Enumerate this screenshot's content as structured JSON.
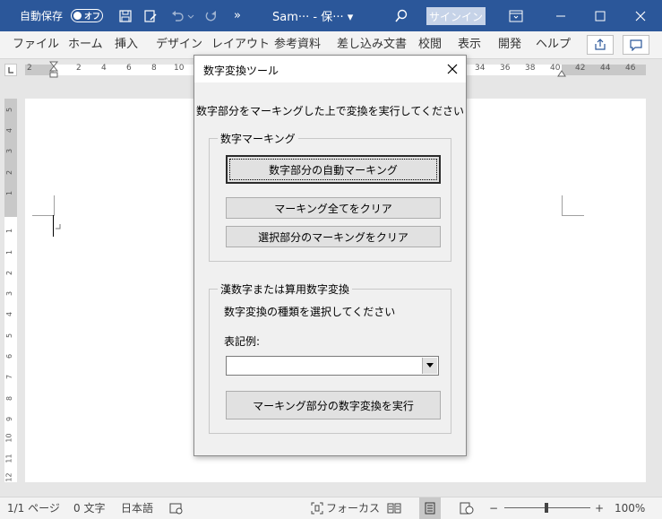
{
  "titlebar": {
    "autosave_label": "自動保存",
    "autosave_toggle": "オフ",
    "doc_title": "Sam···  - 保··· ▾",
    "signin_label": "サインイン",
    "bg_color": "#2b579a"
  },
  "ribbon": {
    "tabs": [
      "ファイル",
      "ホーム",
      "挿入",
      "デザイン",
      "レイアウト",
      "参考資料",
      "差し込み文書",
      "校閲",
      "表示",
      "開発",
      "ヘルプ"
    ]
  },
  "ruler": {
    "left_numbers": [
      "2",
      "2",
      "4",
      "6",
      "8",
      "10"
    ],
    "right_numbers": [
      "34",
      "36",
      "38",
      "40",
      "42",
      "44",
      "46"
    ]
  },
  "vruler": {
    "numbers": [
      "5",
      "4",
      "3",
      "2",
      "1",
      "1",
      "1",
      "2",
      "3",
      "4",
      "5",
      "6",
      "7",
      "8",
      "9",
      "10",
      "11",
      "12"
    ]
  },
  "dialog": {
    "title": "数字変換ツール",
    "instruction": "数字部分をマーキングした上で変換を実行してください",
    "group1": {
      "label": "数字マーキング",
      "auto_mark_button": "数字部分の自動マーキング",
      "clear_all_button": "マーキング全てをクリア",
      "clear_selection_button": "選択部分のマーキングをクリア"
    },
    "group2": {
      "label": "漢数字または算用数字変換",
      "select_prompt": "数字変換の種類を選択してください",
      "example_label": "表記例:",
      "combo_value": "",
      "execute_button": "マーキング部分の数字変換を実行"
    }
  },
  "statusbar": {
    "page": "1/1 ページ",
    "words": "0 文字",
    "language": "日本語",
    "focus": "フォーカス",
    "zoom_minus": "−",
    "zoom_plus": "+",
    "zoom_level": "100%"
  }
}
